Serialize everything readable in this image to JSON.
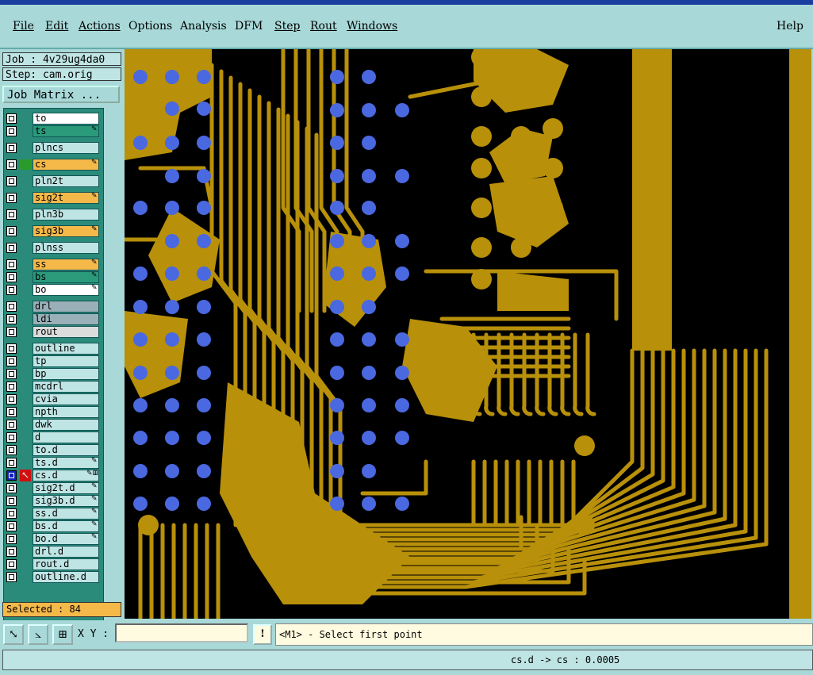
{
  "menu": {
    "file": "File",
    "edit": "Edit",
    "actions": "Actions",
    "options": "Options",
    "analysis": "Analysis",
    "dfm": "DFM",
    "step": "Step",
    "rout": "Rout",
    "windows": "Windows",
    "help": "Help"
  },
  "panel": {
    "job": "Job : 4v29ug4da0",
    "step": "Step: cam.orig",
    "job_matrix": "Job Matrix ...",
    "selected": "Selected : 84"
  },
  "layers": [
    {
      "name": "to",
      "color": "#ffffff",
      "mark": ""
    },
    {
      "name": "ts",
      "color": "#2a9a7a",
      "mark": "✎"
    },
    {
      "name": "plncs",
      "color": "#bfe4e4",
      "mark": ""
    },
    {
      "name": "cs",
      "color": "#f5b94a",
      "mark": "✎"
    },
    {
      "name": "pln2t",
      "color": "#bfe4e4",
      "mark": ""
    },
    {
      "name": "sig2t",
      "color": "#f5b94a",
      "mark": "✎"
    },
    {
      "name": "pln3b",
      "color": "#bfe4e4",
      "mark": ""
    },
    {
      "name": "sig3b",
      "color": "#f5b94a",
      "mark": "✎"
    },
    {
      "name": "plnss",
      "color": "#bfe4e4",
      "mark": ""
    },
    {
      "name": "ss",
      "color": "#f5b94a",
      "mark": "✎"
    },
    {
      "name": "bs",
      "color": "#2a9a7a",
      "mark": "✎"
    },
    {
      "name": "bo",
      "color": "#ffffff",
      "mark": "✎"
    },
    {
      "name": "drl",
      "color": "#9ab0b8",
      "mark": ""
    },
    {
      "name": "ldi",
      "color": "#9ab0b8",
      "mark": ""
    },
    {
      "name": "rout",
      "color": "#dcdcdc",
      "mark": ""
    },
    {
      "name": "outline",
      "color": "#bfe4e4",
      "mark": ""
    },
    {
      "name": "tp",
      "color": "#bfe4e4",
      "mark": ""
    },
    {
      "name": "bp",
      "color": "#bfe4e4",
      "mark": ""
    },
    {
      "name": "mcdrl",
      "color": "#bfe4e4",
      "mark": ""
    },
    {
      "name": "cvia",
      "color": "#bfe4e4",
      "mark": ""
    },
    {
      "name": "npth",
      "color": "#bfe4e4",
      "mark": ""
    },
    {
      "name": "dwk",
      "color": "#bfe4e4",
      "mark": ""
    },
    {
      "name": "d",
      "color": "#bfe4e4",
      "mark": ""
    },
    {
      "name": "to.d",
      "color": "#bfe4e4",
      "mark": ""
    },
    {
      "name": "ts.d",
      "color": "#bfe4e4",
      "mark": "✎"
    },
    {
      "name": "cs.d",
      "color": "#bfe4e4",
      "mark": "✎⊞"
    },
    {
      "name": "sig2t.d",
      "color": "#bfe4e4",
      "mark": "✎"
    },
    {
      "name": "sig3b.d",
      "color": "#bfe4e4",
      "mark": "✎"
    },
    {
      "name": "ss.d",
      "color": "#bfe4e4",
      "mark": "✎"
    },
    {
      "name": "bs.d",
      "color": "#bfe4e4",
      "mark": "✎"
    },
    {
      "name": "bo.d",
      "color": "#bfe4e4",
      "mark": "✎"
    },
    {
      "name": "drl.d",
      "color": "#bfe4e4",
      "mark": ""
    },
    {
      "name": "rout.d",
      "color": "#bfe4e4",
      "mark": ""
    },
    {
      "name": "outline.d",
      "color": "#bfe4e4",
      "mark": ""
    }
  ],
  "bottom": {
    "xy_label": "X Y :",
    "xy_value": "",
    "bang": "!",
    "prompt": "<M1> - Select first point"
  },
  "status": {
    "text": "cs.d -> cs : 0.0005"
  },
  "colors": {
    "copper": "#b8900a",
    "pad": "#4a68e0",
    "board": "#000000",
    "panel": "#a8d8d8"
  }
}
